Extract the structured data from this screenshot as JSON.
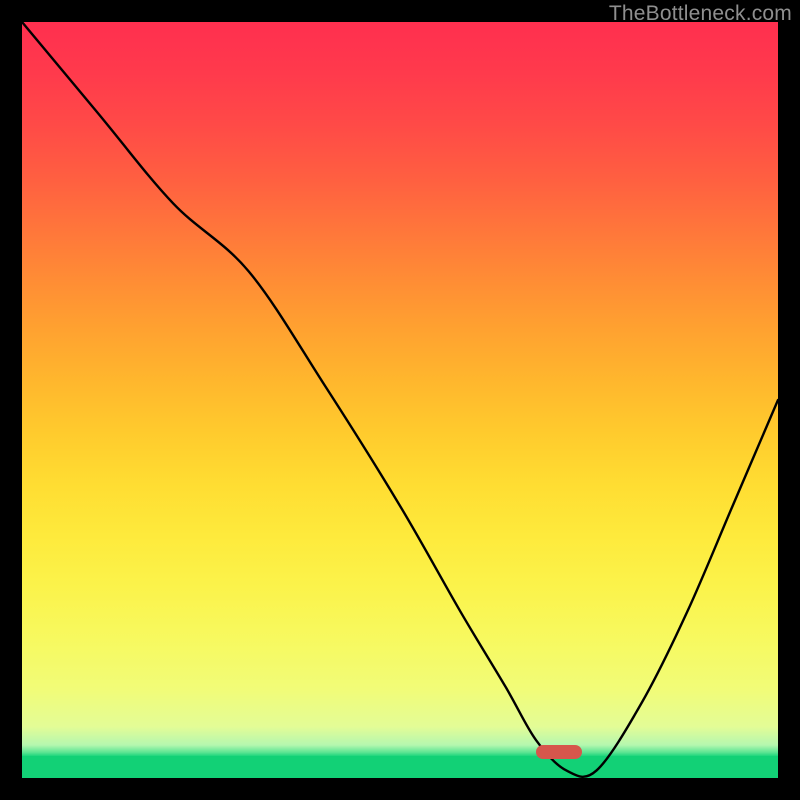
{
  "watermark": "TheBottleneck.com",
  "chart_data": {
    "type": "line",
    "title": "",
    "xlabel": "",
    "ylabel": "",
    "xlim": [
      0,
      100
    ],
    "ylim": [
      0,
      100
    ],
    "series": [
      {
        "name": "curve",
        "x": [
          0,
          10,
          20,
          30,
          40,
          50,
          58,
          64,
          68,
          72,
          76,
          82,
          88,
          94,
          100
        ],
        "y": [
          100,
          88,
          76,
          67,
          52,
          36,
          22,
          12,
          5,
          1,
          1,
          10,
          22,
          36,
          50
        ]
      }
    ],
    "marker": {
      "x": 71,
      "y": 0.5,
      "color": "#d6564c"
    },
    "gradient_stops": [
      {
        "pos": 0,
        "color": "#ff2f4f"
      },
      {
        "pos": 50,
        "color": "#ffb72d"
      },
      {
        "pos": 84,
        "color": "#f7f95f"
      },
      {
        "pos": 100,
        "color": "#1fd67d"
      }
    ]
  }
}
